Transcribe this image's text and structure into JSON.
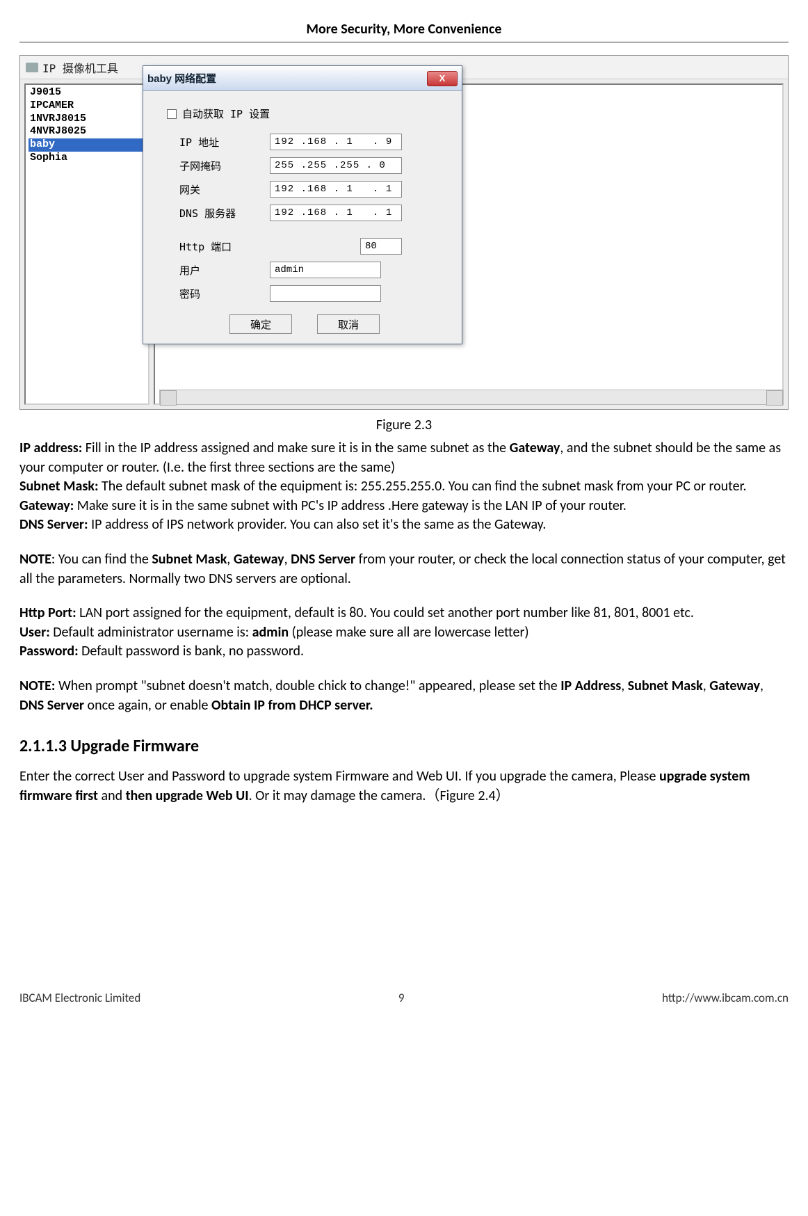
{
  "header": {
    "title": "More Security, More Convenience"
  },
  "tool": {
    "window_title": "IP 摄像机工具",
    "list_items": [
      "J9015",
      "IPCAMER",
      "1NVRJ8015",
      "4NVRJ8025",
      "baby",
      "Sophia"
    ],
    "selected_index": 4
  },
  "dialog": {
    "title": "baby 网络配置",
    "close_glyph": "X",
    "auto_ip": {
      "label": "自动获取 IP 设置",
      "checked": false
    },
    "rows": {
      "ip": {
        "label": "IP 地址",
        "value": "192 .168 . 1   . 9"
      },
      "mask": {
        "label": "子网掩码",
        "value": "255 .255 .255 . 0"
      },
      "gw": {
        "label": "网关",
        "value": "192 .168 . 1   . 1"
      },
      "dns": {
        "label": "DNS 服务器",
        "value": "192 .168 . 1   . 1"
      },
      "port": {
        "label": "Http 端口",
        "value": "80"
      },
      "user": {
        "label": "用户",
        "value": "admin"
      },
      "pass": {
        "label": "密码",
        "value": ""
      }
    },
    "ok_label": "确定",
    "cancel_label": "取消"
  },
  "figure": {
    "caption": "Figure 2.3"
  },
  "text": {
    "ip_label": "IP address:",
    "ip_body": " Fill in the IP address assigned and make sure it is in the same subnet as the ",
    "gateway_word": "Gateway",
    "ip_body2": ", and the subnet should be the same as your computer or router. (I.e. the first three sections are the same)",
    "subnet_label": "Subnet Mask:",
    "subnet_body": " The default subnet mask of the equipment is: 255.255.255.0. You can find the subnet mask from your PC or router.",
    "gw_label": "Gateway:",
    "gw_body": " Make sure it is in the same subnet with PC's IP address .Here gateway is the LAN IP of your router.",
    "dns_label": "DNS Server:",
    "dns_body": " IP address of IPS network provider. You can also set it's the same as the Gateway.",
    "note1_label": "NOTE",
    "note1_a": ": You can find the ",
    "note1_b": "Subnet Mask",
    "note1_c": ", ",
    "note1_d": "Gateway",
    "note1_e": ", ",
    "note1_f": "DNS Server",
    "note1_g": " from your router, or check the local connection status of your computer, get all the parameters. Normally two DNS servers are optional.",
    "http_label": "Http Port:",
    "http_body": " LAN port assigned for the equipment, default is 80. You could set another port number like 81, 801, 8001 etc.",
    "user_label": "User:",
    "user_body_a": " Default administrator username is: ",
    "user_body_b": "admin",
    "user_body_c": " (please make sure all are lowercase letter)",
    "pass_label": "Password:",
    "pass_body": " Default password is bank, no password.",
    "note2_label": "NOTE:",
    "note2_a": " When prompt \"subnet doesn't match, double chick to change!\" appeared, please set the ",
    "note2_b": "IP Address",
    "note2_c": ", ",
    "note2_d": "Subnet Mask",
    "note2_e": ", ",
    "note2_f": "Gateway",
    "note2_g": ", ",
    "note2_h": "DNS Server",
    "note2_i": " once again, or enable ",
    "note2_j": "Obtain IP from DHCP server.",
    "section_heading": "2.1.1.3 Upgrade Firmware",
    "upgrade_a": "Enter the correct User and Password to upgrade system Firmware and Web UI. If you upgrade the camera, Please ",
    "upgrade_b": "upgrade system firmware first",
    "upgrade_c": " and ",
    "upgrade_d": "then upgrade Web UI",
    "upgrade_e": ". Or it may damage the camera.（Figure 2.4）"
  },
  "footer": {
    "company": "IBCAM Electronic Limited",
    "page": "9",
    "url": "http://www.ibcam.com.cn"
  }
}
